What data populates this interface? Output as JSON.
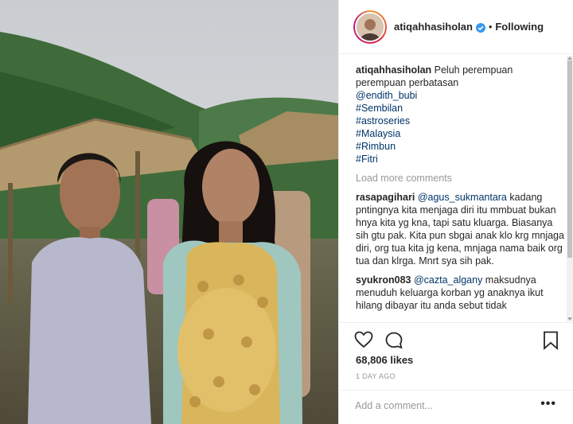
{
  "profile": {
    "username": "atiqahhasiholan",
    "verified": true,
    "separator": "•",
    "follow_status": "Following"
  },
  "caption": {
    "username": "atiqahhasiholan",
    "text": "Peluh perempuan perempuan perbatasan",
    "mention": "@endith_bubi",
    "hashtags": [
      "#Sembilan",
      "#astroseries",
      "#Malaysia",
      "#Rimbun",
      "#Fitri"
    ]
  },
  "load_more": "Load more comments",
  "comments": [
    {
      "username": "rasapagihari",
      "mention": "@agus_sukmantara",
      "text": " kadang pntingnya kita menjaga diri itu mmbuat bukan hnya kita yg kna, tapi satu kluarga. Biasanya sih gtu pak. Kita pun sbgai anak klo krg mnjaga diri, org tua kita jg kena, mnjaga nama baik org tua dan klrga. Mnrt sya sih pak."
    },
    {
      "username": "syukron083",
      "mention": "@cazta_algany",
      "text": " maksudnya menuduh keluarga korban yg anaknya ikut hilang dibayar itu anda sebut tidak"
    }
  ],
  "actions": {
    "like_icon": "heart-outline-icon",
    "comment_icon": "comment-bubble-icon",
    "save_icon": "bookmark-icon"
  },
  "likes": "68,806 likes",
  "timestamp": "1 DAY AGO",
  "add_comment": {
    "placeholder": "Add a comment...",
    "more_label": "•••"
  },
  "colors": {
    "link": "#003569",
    "verified": "#3897f0",
    "muted": "#999999"
  }
}
